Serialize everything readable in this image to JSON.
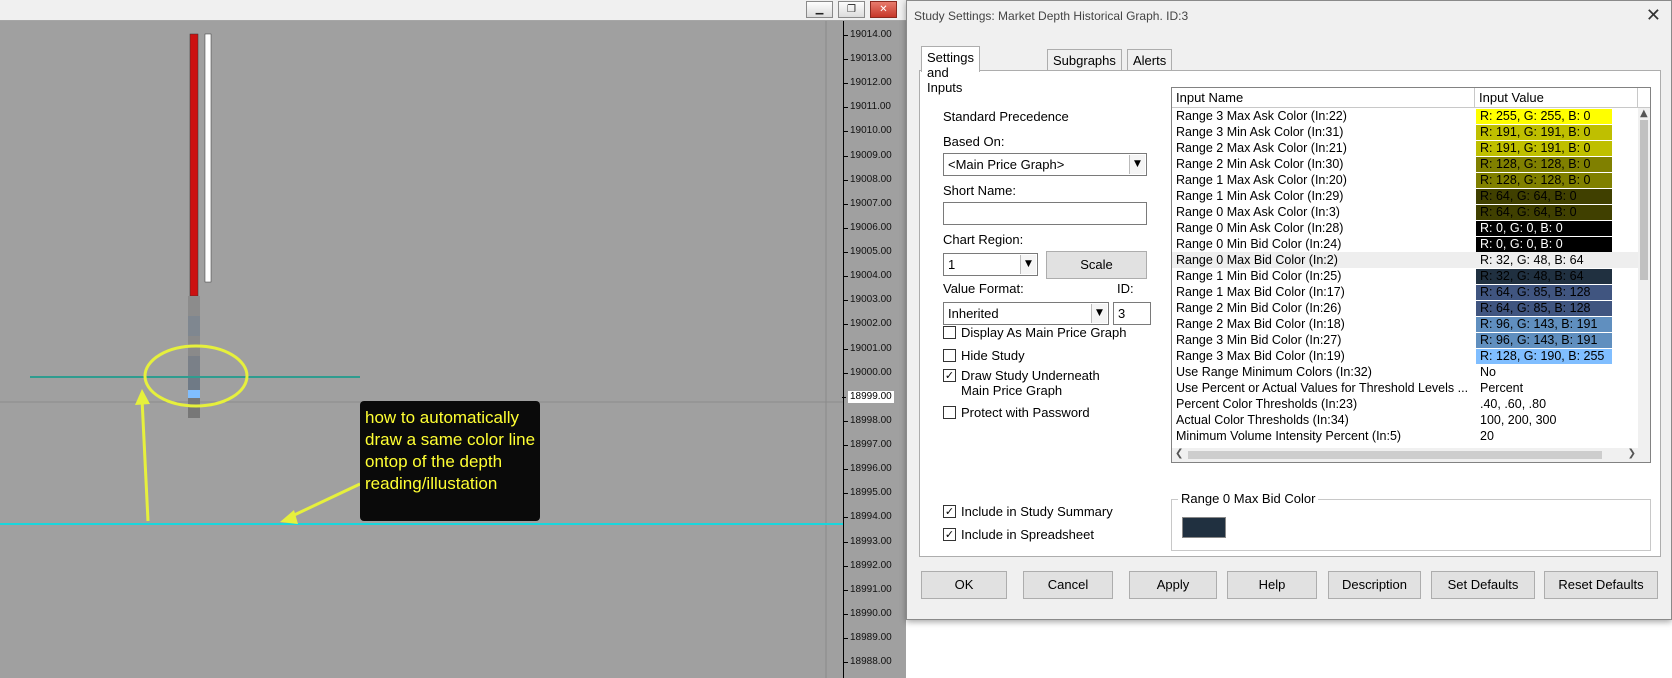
{
  "chart": {
    "price_ticks": [
      "19014.00",
      "19013.00",
      "19012.00",
      "19011.00",
      "19010.00",
      "19009.00",
      "19008.00",
      "19007.00",
      "19006.00",
      "19005.00",
      "19004.00",
      "19003.00",
      "19002.00",
      "19001.00",
      "19000.00",
      "18999.00",
      "18998.00",
      "18997.00",
      "18996.00",
      "18995.00",
      "18994.00",
      "18993.00",
      "18992.00",
      "18991.00",
      "18990.00",
      "18989.00",
      "18988.00"
    ],
    "current_price": "18999.00",
    "annotation": "how to automatically draw a same color line ontop of the depth reading/illustation",
    "colors": {
      "annotation_yellow": "#e6f03c",
      "cyan_line": "#19d6dc",
      "teal_line": "#2f9c8f",
      "ask_red": "#cc1111"
    }
  },
  "dialog": {
    "title": "Study Settings: Market Depth Historical Graph. ID:3",
    "close_glyph": "✕",
    "tabs": [
      "Settings and Inputs",
      "Subgraphs",
      "Alerts"
    ],
    "standard_precedence": "Standard Precedence",
    "based_on_label": "Based On:",
    "based_on_value": "<Main Price Graph>",
    "short_name_label": "Short Name:",
    "short_name_value": "",
    "chart_region_label": "Chart Region:",
    "chart_region_value": "1",
    "scale_button": "Scale",
    "value_format_label": "Value Format:",
    "value_format_value": "Inherited",
    "id_label": "ID:",
    "id_value": "3",
    "checkboxes": [
      {
        "label": "Display As Main Price Graph",
        "checked": false
      },
      {
        "label": "Hide Study",
        "checked": false
      },
      {
        "label": "Draw Study Underneath",
        "label2": "Main Price Graph",
        "checked": true
      },
      {
        "label": "Protect with Password",
        "checked": false
      }
    ],
    "bottom_checkboxes": [
      {
        "label": "Include in Study Summary",
        "checked": true
      },
      {
        "label": "Include in Spreadsheet",
        "checked": true
      }
    ],
    "grid": {
      "headers": [
        "Input Name",
        "Input Value"
      ],
      "rows": [
        {
          "name": "Range 3 Max Ask Color  (In:22)",
          "value": "R: 255, G: 255, B: 0",
          "bg": "#ffff00",
          "fg": "#000000"
        },
        {
          "name": "Range 3 Min Ask Color  (In:31)",
          "value": "R: 191, G: 191, B: 0",
          "bg": "#bfbf00",
          "fg": "#000000"
        },
        {
          "name": "Range 2 Max Ask Color  (In:21)",
          "value": "R: 191, G: 191, B: 0",
          "bg": "#bfbf00",
          "fg": "#000000"
        },
        {
          "name": "Range 2 Min Ask Color  (In:30)",
          "value": "R: 128, G: 128, B: 0",
          "bg": "#808000",
          "fg": "#000000"
        },
        {
          "name": "Range 1 Max Ask Color  (In:20)",
          "value": "R: 128, G: 128, B: 0",
          "bg": "#808000",
          "fg": "#000000"
        },
        {
          "name": "Range 1 Min Ask Color  (In:29)",
          "value": "R: 64, G: 64, B: 0",
          "bg": "#404000",
          "fg": "#000000"
        },
        {
          "name": "Range 0 Max Ask Color  (In:3)",
          "value": "R: 64, G: 64, B: 0",
          "bg": "#404000",
          "fg": "#000000"
        },
        {
          "name": "Range 0 Min Ask Color  (In:28)",
          "value": "R: 0, G: 0, B: 0",
          "bg": "#000000",
          "fg": "#ffffff"
        },
        {
          "name": "Range 0 Min Bid Color  (In:24)",
          "value": "R: 0, G: 0, B: 0",
          "bg": "#000000",
          "fg": "#ffffff"
        },
        {
          "name": "Range 0 Max Bid Color  (In:2)",
          "value": "R: 32, G: 48, B: 64",
          "bg": "",
          "fg": "#000000",
          "selected": true
        },
        {
          "name": "Range 1 Min Bid Color  (In:25)",
          "value": "R: 32, G: 48, B: 64",
          "bg": "#203040",
          "fg": "#000000"
        },
        {
          "name": "Range 1 Max Bid Color  (In:17)",
          "value": "R: 64, G: 85, B: 128",
          "bg": "#405580",
          "fg": "#000000"
        },
        {
          "name": "Range 2 Min Bid Color  (In:26)",
          "value": "R: 64, G: 85, B: 128",
          "bg": "#405580",
          "fg": "#000000"
        },
        {
          "name": "Range 2 Max Bid Color  (In:18)",
          "value": "R: 96, G: 143, B: 191",
          "bg": "#608fbf",
          "fg": "#000000"
        },
        {
          "name": "Range 3 Min Bid Color  (In:27)",
          "value": "R: 96, G: 143, B: 191",
          "bg": "#608fbf",
          "fg": "#000000"
        },
        {
          "name": "Range 3 Max Bid Color  (In:19)",
          "value": "R: 128, G: 190, B: 255",
          "bg": "#80beff",
          "fg": "#000000"
        },
        {
          "name": "Use Range Minimum Colors  (In:32)",
          "value": "No",
          "bg": "",
          "fg": "#000000"
        },
        {
          "name": "Use Percent or Actual Values for Threshold Levels  ...",
          "value": "Percent",
          "bg": "",
          "fg": "#000000"
        },
        {
          "name": "Percent Color Thresholds  (In:23)",
          "value": ".40, .60, .80",
          "bg": "",
          "fg": "#000000"
        },
        {
          "name": "Actual Color Thresholds  (In:34)",
          "value": "100, 200, 300",
          "bg": "",
          "fg": "#000000"
        },
        {
          "name": "Minimum Volume Intensity Percent  (In:5)",
          "value": "20",
          "bg": "",
          "fg": "#000000"
        }
      ]
    },
    "color_group_title": "Range 0 Max Bid Color",
    "color_group_swatch": "#203040",
    "buttons": [
      "OK",
      "Cancel",
      "Apply",
      "Help",
      "Description",
      "Set Defaults",
      "Reset Defaults"
    ]
  }
}
